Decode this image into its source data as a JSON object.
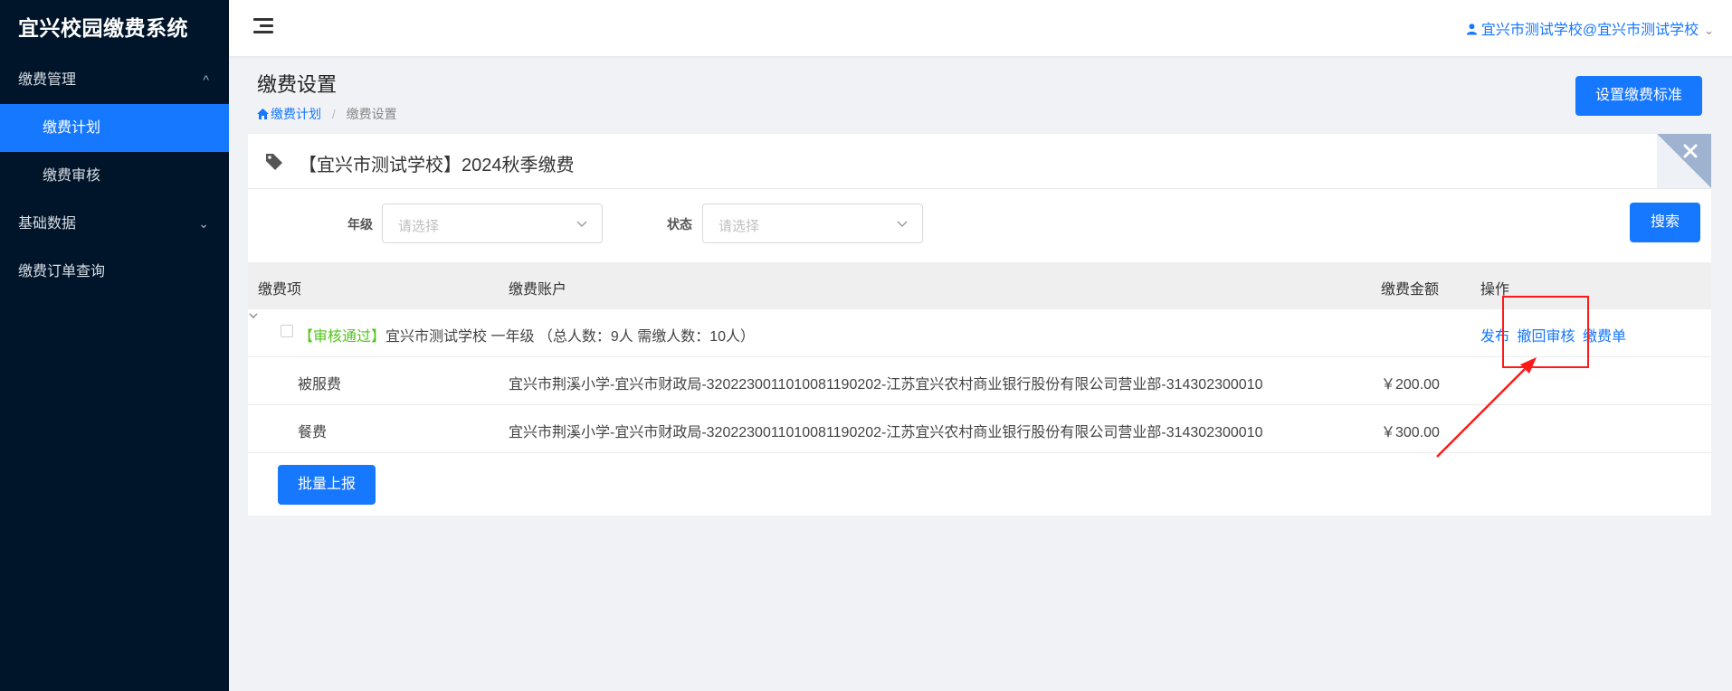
{
  "app": {
    "title": "宜兴校园缴费系统"
  },
  "sidebar": {
    "items": [
      {
        "label": "缴费管理",
        "chevron": "^"
      },
      {
        "label": "缴费计划"
      },
      {
        "label": "缴费审核"
      },
      {
        "label": "基础数据",
        "chevron": "⌄"
      },
      {
        "label": "缴费订单查询"
      }
    ]
  },
  "topbar": {
    "user": "宜兴市测试学校@宜兴市测试学校",
    "user_caret": "⌄"
  },
  "page": {
    "title": "缴费设置",
    "breadcrumb": {
      "home": "缴费计划",
      "separator": "/",
      "current": "缴费设置"
    },
    "set_standard_button": "设置缴费标准"
  },
  "card": {
    "title": "【宜兴市测试学校】2024秋季缴费",
    "filters": {
      "grade_label": "年级",
      "grade_placeholder": "请选择",
      "status_label": "状态",
      "status_placeholder": "请选择",
      "search_button": "搜索"
    },
    "table": {
      "headers": {
        "item": "缴费项",
        "account": "缴费账户",
        "amount": "缴费金额",
        "operation": "操作"
      },
      "group": {
        "status": "【审核通过】",
        "text": "宜兴市测试学校 一年级 （总人数：9人 需缴人数：10人）",
        "actions": {
          "publish": "发布",
          "revoke": "撤回审核",
          "bill": "缴费单"
        }
      },
      "rows": [
        {
          "item": "被服费",
          "account": "宜兴市荆溪小学-宜兴市财政局-320223001101008119020​2-江苏宜兴农村商业银行股份有限公司营业部-314302300010",
          "amount": "￥200.00"
        },
        {
          "item": "餐费",
          "account": "宜兴市荆溪小学-宜兴市财政局-320223001101008119020​2-江苏宜兴农村商业银行股份有限公司营业部-314302300010",
          "amount": "￥300.00"
        }
      ]
    },
    "batch_button": "批量上报"
  },
  "colors": {
    "primary": "#1677ff",
    "sidebar_bg": "#001529",
    "approved": "#52c41a",
    "annotation": "#ff1a1a"
  },
  "icons": [
    "hamburger-icon",
    "person-icon",
    "home-icon",
    "tag-icon",
    "close-icon",
    "chevron-down-icon",
    "expand-icon",
    "arrow-annotation"
  ]
}
